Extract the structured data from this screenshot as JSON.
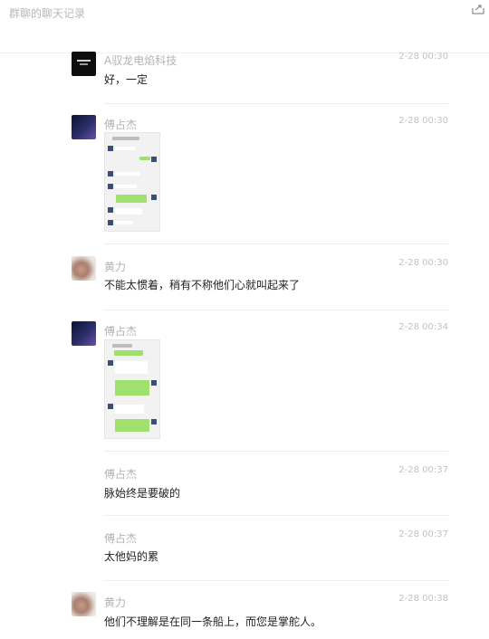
{
  "window": {
    "title": "群聊的聊天记录",
    "share_icon": "share-icon"
  },
  "messages": [
    {
      "sender": "A驭龙电焰科技",
      "time": "2-28 00:30",
      "text": "好，一定"
    },
    {
      "sender": "傅占杰",
      "time": "2-28 00:30",
      "image": "chat-screenshot"
    },
    {
      "sender": "黄力",
      "time": "2-28 00:30",
      "text": "不能太惯着，稍有不称他们心就叫起来了"
    },
    {
      "sender": "傅占杰",
      "time": "2-28 00:34",
      "image": "chat-screenshot"
    },
    {
      "sender": "傅占杰",
      "time": "2-28 00:37",
      "text": "脉始终是要破的"
    },
    {
      "sender": "傅占杰",
      "time": "2-28 00:37",
      "text": "太他妈的累"
    },
    {
      "sender": "黄力",
      "time": "2-28 00:38",
      "text": "他们不理解是在同一条船上，而您是掌舵人。"
    }
  ]
}
